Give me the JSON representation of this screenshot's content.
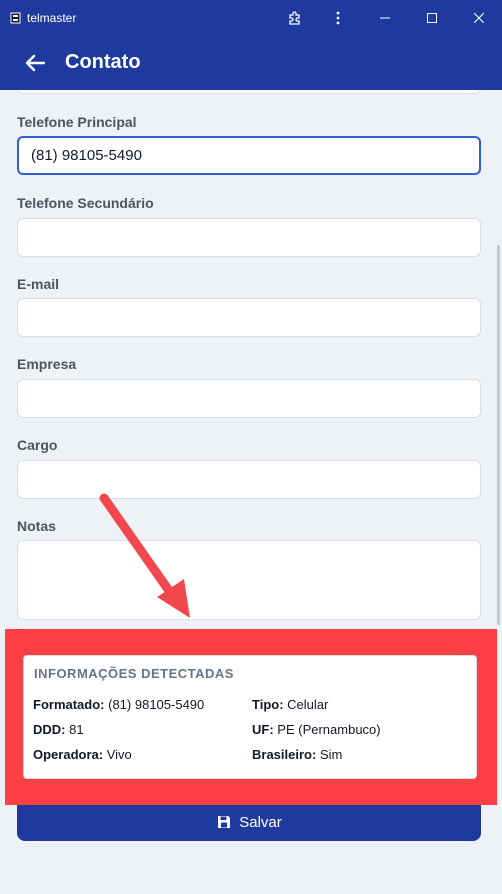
{
  "window": {
    "title": "telmaster",
    "icons": [
      "app-icon",
      "extension-icon",
      "more-icon",
      "minimize-icon",
      "maximize-icon",
      "close-icon"
    ]
  },
  "header": {
    "title": "Contato",
    "back_icon": "arrow-left-icon"
  },
  "form": {
    "primary_phone": {
      "label": "Telefone Principal",
      "value": "(81) 98105-5490"
    },
    "secondary_phone": {
      "label": "Telefone Secundário",
      "value": ""
    },
    "email": {
      "label": "E-mail",
      "value": ""
    },
    "company": {
      "label": "Empresa",
      "value": ""
    },
    "role": {
      "label": "Cargo",
      "value": ""
    },
    "notes": {
      "label": "Notas",
      "value": ""
    }
  },
  "detected": {
    "heading": "INFORMAÇÕES DETECTADAS",
    "formatted": {
      "label": "Formatado:",
      "value": "(81) 98105-5490"
    },
    "type": {
      "label": "Tipo:",
      "value": "Celular"
    },
    "ddd": {
      "label": "DDD:",
      "value": "81"
    },
    "uf": {
      "label": "UF:",
      "value": "PE (Pernambuco)"
    },
    "carrier": {
      "label": "Operadora:",
      "value": "Vivo"
    },
    "brazilian": {
      "label": "Brasileiro:",
      "value": "Sim"
    }
  },
  "actions": {
    "save_label": "Salvar",
    "save_icon": "floppy-disk-icon"
  },
  "colors": {
    "primary": "#1e3a9f",
    "highlight": "#fb3f44",
    "focus": "#2f5fd0",
    "background": "#eef1f6"
  }
}
